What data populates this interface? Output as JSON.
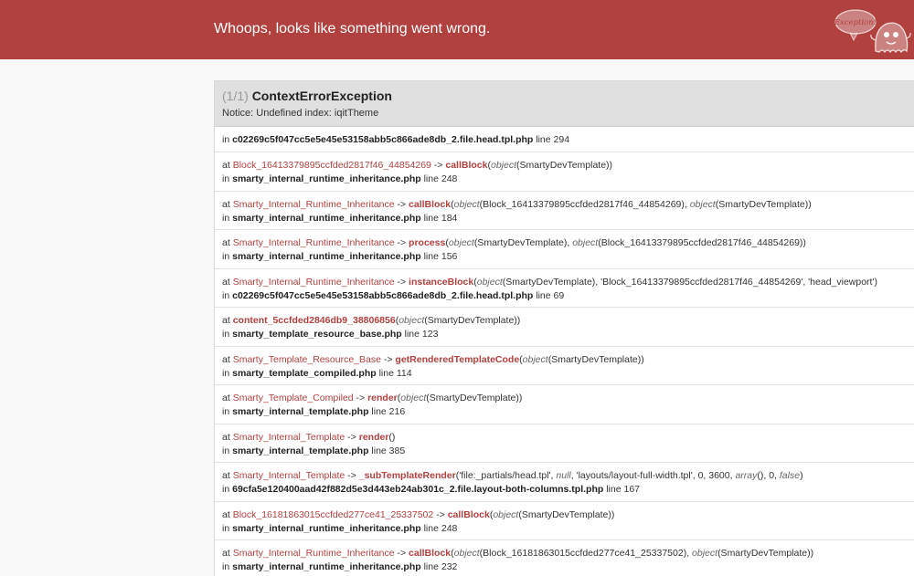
{
  "header": {
    "title": "Whoops, looks like something went wrong.",
    "badge": "Exception!"
  },
  "exception": {
    "count": "(1/1)",
    "name": "ContextErrorException",
    "message": "Notice: Undefined index: iqitTheme"
  },
  "first_location": {
    "prefix": "in",
    "file": "c02269c5f047cc5e5e45e53158abb5c866ade8db_2.file.head.tpl.php",
    "line": "line 294"
  },
  "frames": [
    {
      "prefix": "at",
      "cls": "Block_16413379895ccfded2817f46_44854269",
      "arrow": "->",
      "fn": "callBlock",
      "args": [
        [
          "(",
          ""
        ],
        [
          "object",
          "obj"
        ],
        [
          "(SmartyDevTemplate))",
          ""
        ]
      ],
      "in": "in",
      "file": "smarty_internal_runtime_inheritance.php",
      "line": "line 248"
    },
    {
      "prefix": "at",
      "cls": "Smarty_Internal_Runtime_Inheritance",
      "arrow": "->",
      "fn": "callBlock",
      "args": [
        [
          "(",
          ""
        ],
        [
          "object",
          "obj"
        ],
        [
          "(Block_16413379895ccfded2817f46_44854269), ",
          ""
        ],
        [
          "object",
          "obj"
        ],
        [
          "(SmartyDevTemplate))",
          ""
        ]
      ],
      "in": "in",
      "file": "smarty_internal_runtime_inheritance.php",
      "line": "line 184"
    },
    {
      "prefix": "at",
      "cls": "Smarty_Internal_Runtime_Inheritance",
      "arrow": "->",
      "fn": "process",
      "args": [
        [
          "(",
          ""
        ],
        [
          "object",
          "obj"
        ],
        [
          "(SmartyDevTemplate), ",
          ""
        ],
        [
          "object",
          "obj"
        ],
        [
          "(Block_16413379895ccfded2817f46_44854269))",
          ""
        ]
      ],
      "in": "in",
      "file": "smarty_internal_runtime_inheritance.php",
      "line": "line 156"
    },
    {
      "prefix": "at",
      "cls": "Smarty_Internal_Runtime_Inheritance",
      "arrow": "->",
      "fn": "instanceBlock",
      "args": [
        [
          "(",
          ""
        ],
        [
          "object",
          "obj"
        ],
        [
          "(SmartyDevTemplate), 'Block_16413379895ccfded2817f46_44854269', 'head_viewport')",
          ""
        ]
      ],
      "in": "in",
      "file": "c02269c5f047cc5e5e45e53158abb5c866ade8db_2.file.head.tpl.php",
      "line": "line 69"
    },
    {
      "prefix": "at ",
      "cls": "",
      "arrow": "",
      "fn": "content_5ccfded2846db9_38806856",
      "args": [
        [
          "(",
          ""
        ],
        [
          "object",
          "obj"
        ],
        [
          "(SmartyDevTemplate))",
          ""
        ]
      ],
      "in": "in",
      "file": "smarty_template_resource_base.php",
      "line": "line 123"
    },
    {
      "prefix": "at",
      "cls": "Smarty_Template_Resource_Base",
      "arrow": "->",
      "fn": "getRenderedTemplateCode",
      "args": [
        [
          "(",
          ""
        ],
        [
          "object",
          "obj"
        ],
        [
          "(SmartyDevTemplate))",
          ""
        ]
      ],
      "in": "in",
      "file": "smarty_template_compiled.php",
      "line": "line 114"
    },
    {
      "prefix": "at",
      "cls": "Smarty_Template_Compiled",
      "arrow": "->",
      "fn": "render",
      "args": [
        [
          "(",
          ""
        ],
        [
          "object",
          "obj"
        ],
        [
          "(SmartyDevTemplate))",
          ""
        ]
      ],
      "in": "in",
      "file": "smarty_internal_template.php",
      "line": "line 216"
    },
    {
      "prefix": "at",
      "cls": "Smarty_Internal_Template",
      "arrow": "->",
      "fn": "render",
      "args": [
        [
          "()",
          ""
        ]
      ],
      "in": "in",
      "file": "smarty_internal_template.php",
      "line": "line 385"
    },
    {
      "prefix": "at",
      "cls": "Smarty_Internal_Template",
      "arrow": "->",
      "fn": "_subTemplateRender",
      "args": [
        [
          "('file:_partials/head.tpl', ",
          ""
        ],
        [
          "null",
          "obj"
        ],
        [
          ", 'layouts/layout-full-width.tpl', 0, 3600, ",
          ""
        ],
        [
          "array",
          "obj"
        ],
        [
          "(), 0, ",
          ""
        ],
        [
          "false",
          "obj"
        ],
        [
          ")",
          ""
        ]
      ],
      "in": "in",
      "file": "69cfa5e120400aad42f882d5e3d443eb24ab301c_2.file.layout-both-columns.tpl.php",
      "line": "line 167"
    },
    {
      "prefix": "at",
      "cls": "Block_16181863015ccfded277ce41_25337502",
      "arrow": "->",
      "fn": "callBlock",
      "args": [
        [
          "(",
          ""
        ],
        [
          "object",
          "obj"
        ],
        [
          "(SmartyDevTemplate))",
          ""
        ]
      ],
      "in": "in",
      "file": "smarty_internal_runtime_inheritance.php",
      "line": "line 248"
    },
    {
      "prefix": "at",
      "cls": "Smarty_Internal_Runtime_Inheritance",
      "arrow": "->",
      "fn": "callBlock",
      "args": [
        [
          "(",
          ""
        ],
        [
          "object",
          "obj"
        ],
        [
          "(Block_16181863015ccfded277ce41_25337502), ",
          ""
        ],
        [
          "object",
          "obj"
        ],
        [
          "(SmartyDevTemplate))",
          ""
        ]
      ],
      "in": "in",
      "file": "smarty_internal_runtime_inheritance.php",
      "line": "line 232"
    }
  ]
}
